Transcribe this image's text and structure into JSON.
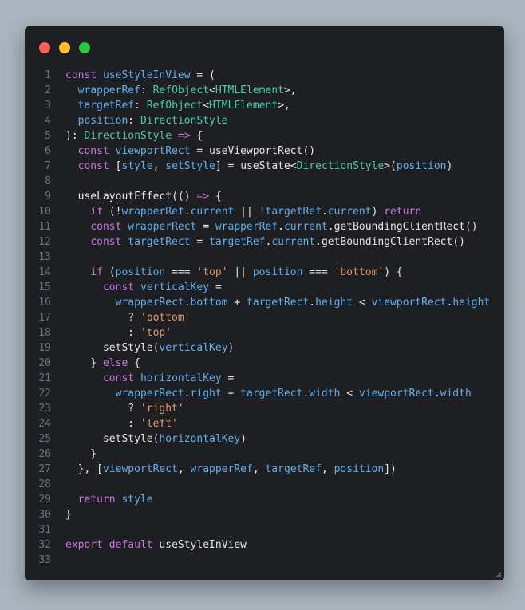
{
  "window": {
    "controls": [
      "close",
      "minimize",
      "maximize"
    ]
  },
  "code": {
    "language": "typescript",
    "lines": [
      {
        "n": "1",
        "parts": [
          [
            "k",
            "const "
          ],
          [
            "v",
            "useStyleInView"
          ],
          [
            "o",
            " = ("
          ]
        ]
      },
      {
        "n": "2",
        "parts": [
          [
            "o",
            "  "
          ],
          [
            "v",
            "wrapperRef"
          ],
          [
            "o",
            ": "
          ],
          [
            "t",
            "RefObject"
          ],
          [
            "o",
            "<"
          ],
          [
            "t",
            "HTMLElement"
          ],
          [
            "o",
            ">,"
          ]
        ]
      },
      {
        "n": "3",
        "parts": [
          [
            "o",
            "  "
          ],
          [
            "v",
            "targetRef"
          ],
          [
            "o",
            ": "
          ],
          [
            "t",
            "RefObject"
          ],
          [
            "o",
            "<"
          ],
          [
            "t",
            "HTMLElement"
          ],
          [
            "o",
            ">,"
          ]
        ]
      },
      {
        "n": "4",
        "parts": [
          [
            "o",
            "  "
          ],
          [
            "v",
            "position"
          ],
          [
            "o",
            ": "
          ],
          [
            "t",
            "DirectionStyle"
          ]
        ]
      },
      {
        "n": "5",
        "parts": [
          [
            "o",
            "): "
          ],
          [
            "t",
            "DirectionStyle"
          ],
          [
            "k",
            " => "
          ],
          [
            "o",
            "{"
          ]
        ]
      },
      {
        "n": "6",
        "parts": [
          [
            "o",
            "  "
          ],
          [
            "k",
            "const "
          ],
          [
            "v",
            "viewportRect"
          ],
          [
            "o",
            " = "
          ],
          [
            "f",
            "useViewportRect"
          ],
          [
            "o",
            "()"
          ]
        ]
      },
      {
        "n": "7",
        "parts": [
          [
            "o",
            "  "
          ],
          [
            "k",
            "const "
          ],
          [
            "o",
            "["
          ],
          [
            "v",
            "style"
          ],
          [
            "o",
            ", "
          ],
          [
            "v",
            "setStyle"
          ],
          [
            "o",
            "] = "
          ],
          [
            "f",
            "useState"
          ],
          [
            "o",
            "<"
          ],
          [
            "t",
            "DirectionStyle"
          ],
          [
            "o",
            ">("
          ],
          [
            "v",
            "position"
          ],
          [
            "o",
            ")"
          ]
        ]
      },
      {
        "n": "8",
        "parts": []
      },
      {
        "n": "9",
        "parts": [
          [
            "o",
            "  "
          ],
          [
            "f",
            "useLayoutEffect"
          ],
          [
            "o",
            "(() "
          ],
          [
            "k",
            "=>"
          ],
          [
            "o",
            " {"
          ]
        ]
      },
      {
        "n": "10",
        "parts": [
          [
            "o",
            "    "
          ],
          [
            "k",
            "if "
          ],
          [
            "o",
            "(!"
          ],
          [
            "v",
            "wrapperRef"
          ],
          [
            "o",
            "."
          ],
          [
            "v",
            "current"
          ],
          [
            "o",
            " || !"
          ],
          [
            "v",
            "targetRef"
          ],
          [
            "o",
            "."
          ],
          [
            "v",
            "current"
          ],
          [
            "o",
            ") "
          ],
          [
            "k",
            "return"
          ]
        ]
      },
      {
        "n": "11",
        "parts": [
          [
            "o",
            "    "
          ],
          [
            "k",
            "const "
          ],
          [
            "v",
            "wrapperRect"
          ],
          [
            "o",
            " = "
          ],
          [
            "v",
            "wrapperRef"
          ],
          [
            "o",
            "."
          ],
          [
            "v",
            "current"
          ],
          [
            "o",
            "."
          ],
          [
            "f",
            "getBoundingClientRect"
          ],
          [
            "o",
            "()"
          ]
        ]
      },
      {
        "n": "12",
        "parts": [
          [
            "o",
            "    "
          ],
          [
            "k",
            "const "
          ],
          [
            "v",
            "targetRect"
          ],
          [
            "o",
            " = "
          ],
          [
            "v",
            "targetRef"
          ],
          [
            "o",
            "."
          ],
          [
            "v",
            "current"
          ],
          [
            "o",
            "."
          ],
          [
            "f",
            "getBoundingClientRect"
          ],
          [
            "o",
            "()"
          ]
        ]
      },
      {
        "n": "13",
        "parts": []
      },
      {
        "n": "14",
        "parts": [
          [
            "o",
            "    "
          ],
          [
            "k",
            "if "
          ],
          [
            "o",
            "("
          ],
          [
            "v",
            "position"
          ],
          [
            "o",
            " === "
          ],
          [
            "s",
            "'top'"
          ],
          [
            "o",
            " || "
          ],
          [
            "v",
            "position"
          ],
          [
            "o",
            " === "
          ],
          [
            "s",
            "'bottom'"
          ],
          [
            "o",
            ") {"
          ]
        ]
      },
      {
        "n": "15",
        "parts": [
          [
            "o",
            "      "
          ],
          [
            "k",
            "const "
          ],
          [
            "v",
            "verticalKey"
          ],
          [
            "o",
            " ="
          ]
        ]
      },
      {
        "n": "16",
        "parts": [
          [
            "o",
            "        "
          ],
          [
            "v",
            "wrapperRect"
          ],
          [
            "o",
            "."
          ],
          [
            "v",
            "bottom"
          ],
          [
            "o",
            " + "
          ],
          [
            "v",
            "targetRect"
          ],
          [
            "o",
            "."
          ],
          [
            "v",
            "height"
          ],
          [
            "o",
            " < "
          ],
          [
            "v",
            "viewportRect"
          ],
          [
            "o",
            "."
          ],
          [
            "v",
            "height"
          ]
        ]
      },
      {
        "n": "17",
        "parts": [
          [
            "o",
            "          ? "
          ],
          [
            "s",
            "'bottom'"
          ]
        ]
      },
      {
        "n": "18",
        "parts": [
          [
            "o",
            "          : "
          ],
          [
            "s",
            "'top'"
          ]
        ]
      },
      {
        "n": "19",
        "parts": [
          [
            "o",
            "      "
          ],
          [
            "f",
            "setStyle"
          ],
          [
            "o",
            "("
          ],
          [
            "v",
            "verticalKey"
          ],
          [
            "o",
            ")"
          ]
        ]
      },
      {
        "n": "20",
        "parts": [
          [
            "o",
            "    } "
          ],
          [
            "k",
            "else "
          ],
          [
            "o",
            "{"
          ]
        ]
      },
      {
        "n": "21",
        "parts": [
          [
            "o",
            "      "
          ],
          [
            "k",
            "const "
          ],
          [
            "v",
            "horizontalKey"
          ],
          [
            "o",
            " ="
          ]
        ]
      },
      {
        "n": "22",
        "parts": [
          [
            "o",
            "        "
          ],
          [
            "v",
            "wrapperRect"
          ],
          [
            "o",
            "."
          ],
          [
            "v",
            "right"
          ],
          [
            "o",
            " + "
          ],
          [
            "v",
            "targetRect"
          ],
          [
            "o",
            "."
          ],
          [
            "v",
            "width"
          ],
          [
            "o",
            " < "
          ],
          [
            "v",
            "viewportRect"
          ],
          [
            "o",
            "."
          ],
          [
            "v",
            "width"
          ]
        ]
      },
      {
        "n": "23",
        "parts": [
          [
            "o",
            "          ? "
          ],
          [
            "s",
            "'right'"
          ]
        ]
      },
      {
        "n": "24",
        "parts": [
          [
            "o",
            "          : "
          ],
          [
            "s",
            "'left'"
          ]
        ]
      },
      {
        "n": "25",
        "parts": [
          [
            "o",
            "      "
          ],
          [
            "f",
            "setStyle"
          ],
          [
            "o",
            "("
          ],
          [
            "v",
            "horizontalKey"
          ],
          [
            "o",
            ")"
          ]
        ]
      },
      {
        "n": "26",
        "parts": [
          [
            "o",
            "    }"
          ]
        ]
      },
      {
        "n": "27",
        "parts": [
          [
            "o",
            "  }, ["
          ],
          [
            "v",
            "viewportRect"
          ],
          [
            "o",
            ", "
          ],
          [
            "v",
            "wrapperRef"
          ],
          [
            "o",
            ", "
          ],
          [
            "v",
            "targetRef"
          ],
          [
            "o",
            ", "
          ],
          [
            "v",
            "position"
          ],
          [
            "o",
            "])"
          ]
        ]
      },
      {
        "n": "28",
        "parts": []
      },
      {
        "n": "29",
        "parts": [
          [
            "o",
            "  "
          ],
          [
            "k",
            "return "
          ],
          [
            "v",
            "style"
          ]
        ]
      },
      {
        "n": "30",
        "parts": [
          [
            "o",
            "}"
          ]
        ]
      },
      {
        "n": "31",
        "parts": []
      },
      {
        "n": "32",
        "parts": [
          [
            "k",
            "export "
          ],
          [
            "k",
            "default "
          ],
          [
            "f",
            "useStyleInView"
          ]
        ]
      },
      {
        "n": "33",
        "parts": []
      }
    ]
  }
}
